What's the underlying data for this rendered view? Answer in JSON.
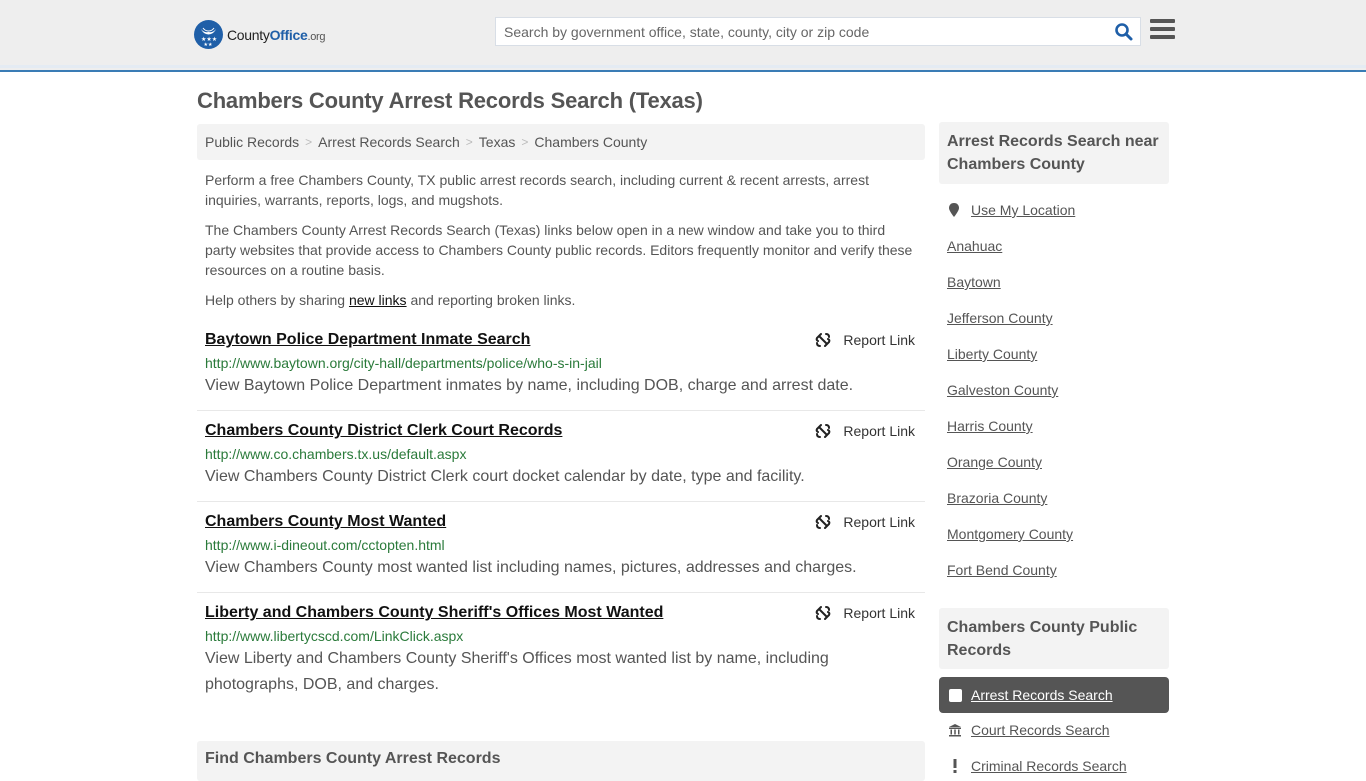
{
  "header": {
    "logo": {
      "county": "County",
      "office": "Office",
      "org": ".org"
    },
    "search_placeholder": "Search by government office, state, county, city or zip code",
    "search_icon": "search-icon",
    "menu_icon": "hamburger-menu-icon",
    "accent_color": "#1f5fa8"
  },
  "page": {
    "title": "Chambers County Arrest Records Search (Texas)",
    "breadcrumb": [
      "Public Records",
      "Arrest Records Search",
      "Texas",
      "Chambers County"
    ],
    "intro": {
      "p1": "Perform a free Chambers County, TX public arrest records search, including current & recent arrests, arrest inquiries, warrants, reports, logs, and mugshots.",
      "p2": "The Chambers County Arrest Records Search (Texas) links below open in a new window and take you to third party websites that provide access to Chambers County public records. Editors frequently monitor and verify these resources on a routine basis.",
      "p3_before": "Help others by sharing ",
      "p3_link": "new links",
      "p3_after": " and reporting broken links."
    },
    "report_label": "Report Link",
    "results": [
      {
        "title": "Baytown Police Department Inmate Search",
        "url": "http://www.baytown.org/city-hall/departments/police/who-s-in-jail",
        "desc": "View Baytown Police Department inmates by name, including DOB, charge and arrest date."
      },
      {
        "title": "Chambers County District Clerk Court Records",
        "url": "http://www.co.chambers.tx.us/default.aspx",
        "desc": "View Chambers County District Clerk court docket calendar by date, type and facility."
      },
      {
        "title": "Chambers County Most Wanted",
        "url": "http://www.i-dineout.com/cctopten.html",
        "desc": "View Chambers County most wanted list including names, pictures, addresses and charges."
      },
      {
        "title": "Liberty and Chambers County Sheriff's Offices Most Wanted",
        "url": "http://www.libertycscd.com/LinkClick.aspx",
        "desc": "View Liberty and Chambers County Sheriff's Offices most wanted list by name, including photographs, DOB, and charges."
      }
    ],
    "find_heading": "Find Chambers County Arrest Records"
  },
  "sidebar": {
    "nearby_heading": "Arrest Records Search near Chambers County",
    "use_location": "Use My Location",
    "nearby": [
      "Anahuac",
      "Baytown",
      "Jefferson County",
      "Liberty County",
      "Galveston County",
      "Harris County",
      "Orange County",
      "Brazoria County",
      "Montgomery County",
      "Fort Bend County"
    ],
    "public_records_heading": "Chambers County Public Records",
    "public_records": [
      {
        "label": "Arrest Records Search",
        "icon": "checkbox-icon",
        "active": true
      },
      {
        "label": "Court Records Search",
        "icon": "courthouse-icon",
        "active": false
      },
      {
        "label": "Criminal Records Search",
        "icon": "exclamation-icon",
        "active": false
      }
    ]
  }
}
